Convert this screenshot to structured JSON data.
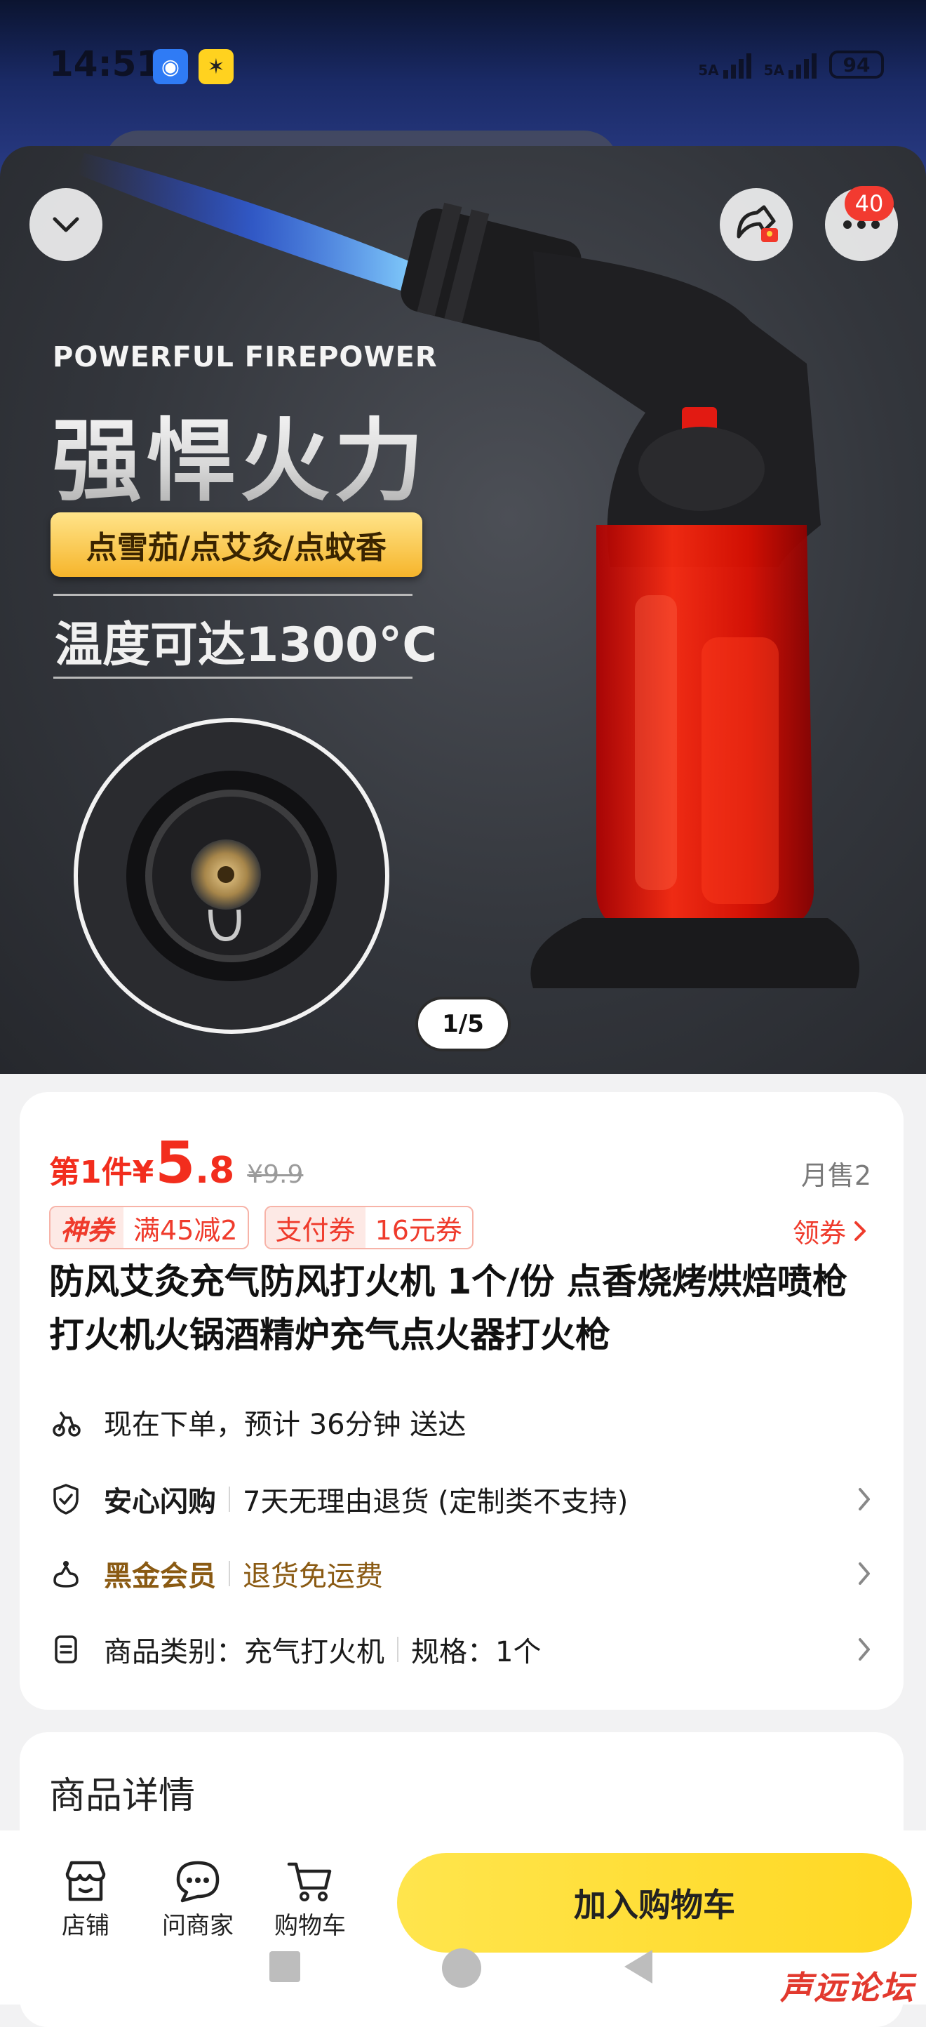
{
  "status_bar": {
    "time": "14:51",
    "app_badges": [
      "shield-app",
      "bunny-app"
    ],
    "signal_1": "5A",
    "signal_2": "5A",
    "battery": "94"
  },
  "hero": {
    "image_text_en": "POWERFUL FIREPOWER",
    "image_title": "强悍火力",
    "image_ribbon": "点雪茄/点艾灸/点蚊香",
    "image_temp": "温度可达1300°C",
    "more_badge_count": "40",
    "pager": "1/5"
  },
  "product": {
    "price_prefix": "第1件¥",
    "price_int": "5",
    "price_dec": ".8",
    "price_old": "¥9.9",
    "monthly_sales": "月售2",
    "coupons": [
      {
        "tag": "神券",
        "text": "满45减2"
      },
      {
        "tag": "支付券",
        "text": "16元券"
      }
    ],
    "get_coupon": "领券",
    "title": "防风艾灸充气防风打火机 1个/份 点香烧烤烘焙喷枪打火机火锅酒精炉充气点火器打火枪",
    "delivery": "现在下单，预计 36分钟 送达",
    "assurance_label": "安心闪购",
    "assurance_text": "7天无理由退货 (定制类不支持)",
    "member_label": "黑金会员",
    "member_text": "退货免运费",
    "category_label": "商品类别：充气打火机",
    "spec_label": "规格：1个"
  },
  "details": {
    "title": "商品详情"
  },
  "bottom_bar": {
    "store": "店铺",
    "ask_seller": "问商家",
    "cart": "购物车",
    "add_to_cart": "加入购物车"
  },
  "watermark": "声远论坛",
  "colors": {
    "price_red": "#f22d1d",
    "cta_yellow": "#ffd823",
    "badge_red": "#f23a30"
  }
}
